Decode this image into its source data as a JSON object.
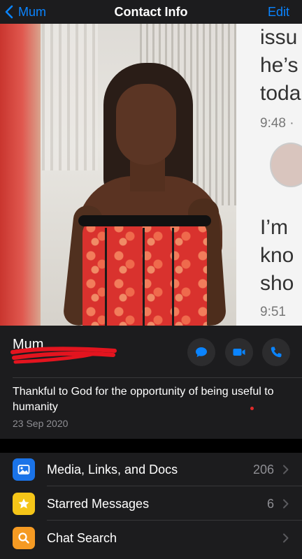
{
  "nav": {
    "back_label": "Mum",
    "title": "Contact Info",
    "edit_label": "Edit"
  },
  "photo": {
    "chat_lines_top": [
      "issu",
      "he’s",
      "toda"
    ],
    "chat_time_top": "9:48 ·",
    "chat_lines_bottom": [
      "I’m",
      "kno",
      "sho"
    ],
    "chat_time_bottom": "9:51"
  },
  "contact": {
    "name": "Mum",
    "status": "Thankful to God for the opportunity of being useful to humanity",
    "status_date": "23 Sep 2020",
    "actions": [
      {
        "icon": "message-icon",
        "color": "#0a84ff"
      },
      {
        "icon": "video-icon",
        "color": "#0a84ff"
      },
      {
        "icon": "phone-icon",
        "color": "#0a84ff"
      }
    ]
  },
  "list": {
    "items": [
      {
        "label": "Media, Links, and Docs",
        "count": "206",
        "icon": "photo-icon",
        "color": "#1a73e8"
      },
      {
        "label": "Starred Messages",
        "count": "6",
        "icon": "star-icon",
        "color": "#f5c518"
      },
      {
        "label": "Chat Search",
        "count": "",
        "icon": "search-icon",
        "color": "#f59a23"
      }
    ]
  },
  "colors": {
    "accent": "#0a84ff",
    "background": "#000000",
    "panel": "#1c1c1e"
  }
}
